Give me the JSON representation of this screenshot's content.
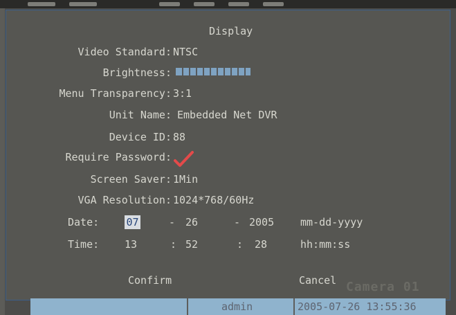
{
  "dialog": {
    "title": "Display",
    "video_standard": {
      "label": "Video Standard:",
      "value": "NTSC"
    },
    "brightness": {
      "label": "Brightness:",
      "level": 1.0
    },
    "menu_transparency": {
      "label": "Menu Transparency:",
      "value": "3:1"
    },
    "unit_name": {
      "label": "Unit Name:",
      "value": "Embedded Net DVR"
    },
    "device_id": {
      "label": "Device ID:",
      "value": "88"
    },
    "require_password": {
      "label": "Require Password:",
      "checked": true,
      "icon": "checkmark-icon"
    },
    "screen_saver": {
      "label": "Screen Saver:",
      "value": "1Min"
    },
    "vga_resolution": {
      "label": "VGA Resolution:",
      "value": "1024*768/60Hz"
    },
    "date": {
      "label": "Date:",
      "month": "07",
      "sep1": "-",
      "day": "26",
      "sep2": "-",
      "year": "2005",
      "format": "mm-dd-yyyy"
    },
    "time": {
      "label": "Time:",
      "hour": "13",
      "sep1": ":",
      "minute": "52",
      "sep2": ":",
      "second": "28",
      "format": "hh:mm:ss"
    },
    "confirm_label": "Confirm",
    "cancel_label": "Cancel"
  },
  "overlay": {
    "camera_label": "Camera 01"
  },
  "status_bar": {
    "user": "admin",
    "datetime": "2005-07-26 13:55:36"
  },
  "colors": {
    "background": "#565652",
    "text": "#d7d7cf",
    "accent": "#8fb3cd",
    "checkmark": "#e34a4a"
  }
}
